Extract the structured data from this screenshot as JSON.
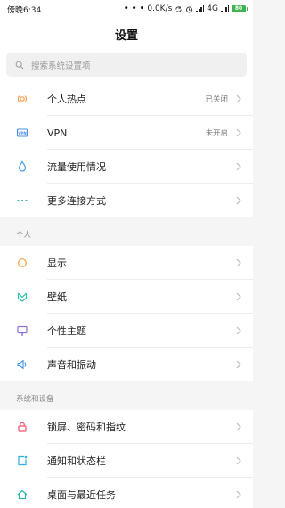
{
  "status_bar": {
    "time": "傍晚6:34",
    "dots": "• • •",
    "speed": "0.0K/s",
    "network": "4G",
    "battery": "80"
  },
  "header": {
    "title": "设置"
  },
  "search": {
    "placeholder": "搜索系统设置项",
    "icon": "search-icon"
  },
  "group_network": {
    "items": [
      {
        "label": "个人热点",
        "value": "已关闭",
        "icon": "hotspot-icon",
        "color": "#f39c4a"
      },
      {
        "label": "VPN",
        "value": "未开启",
        "icon": "vpn-icon",
        "color": "#4a8fe0"
      },
      {
        "label": "流量使用情况",
        "value": "",
        "icon": "data-usage-icon",
        "color": "#3d9fe8"
      },
      {
        "label": "更多连接方式",
        "value": "",
        "icon": "more-connections-icon",
        "color": "#2fb5a8"
      }
    ]
  },
  "group_personal": {
    "title": "个人",
    "items": [
      {
        "label": "显示",
        "value": "",
        "icon": "display-icon",
        "color": "#f5a23c"
      },
      {
        "label": "壁纸",
        "value": "",
        "icon": "wallpaper-icon",
        "color": "#2fc0a8"
      },
      {
        "label": "个性主题",
        "value": "",
        "icon": "theme-icon",
        "color": "#8c6ee0"
      },
      {
        "label": "声音和振动",
        "value": "",
        "icon": "sound-icon",
        "color": "#3a8fe6"
      }
    ]
  },
  "group_system": {
    "title": "系统和设备",
    "items": [
      {
        "label": "锁屏、密码和指纹",
        "value": "",
        "icon": "lock-icon",
        "color": "#f0556a"
      },
      {
        "label": "通知和状态栏",
        "value": "",
        "icon": "notification-icon",
        "color": "#2fb0d8"
      },
      {
        "label": "桌面与最近任务",
        "value": "",
        "icon": "home-icon",
        "color": "#2fb5a8"
      }
    ]
  }
}
